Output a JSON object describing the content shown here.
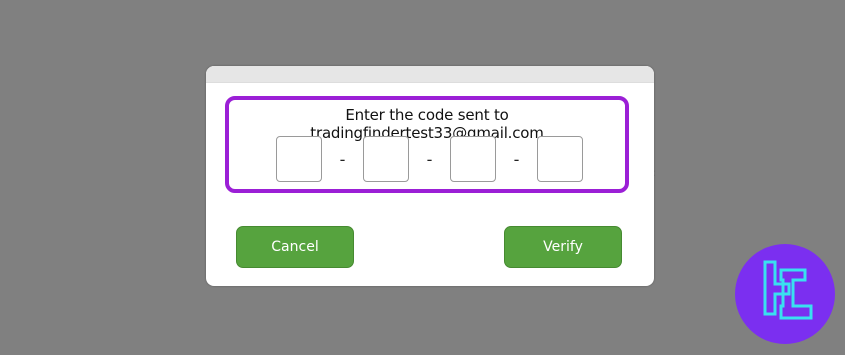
{
  "background": {
    "hint_glyph": ":"
  },
  "modal": {
    "prompt": "Enter the code sent to tradingfindertest33@gmail.com",
    "digits": [
      "",
      "",
      "",
      ""
    ],
    "separator": "-",
    "cancel_label": "Cancel",
    "verify_label": "Verify"
  },
  "colors": {
    "overlay": "#808080",
    "highlight_border": "#9b1fd6",
    "button_green": "#56a33e",
    "logo_bg": "#7b2ff0",
    "logo_stroke": "#39e0f0"
  },
  "icons": {
    "watermark": "tradingfinder-logo-icon"
  }
}
